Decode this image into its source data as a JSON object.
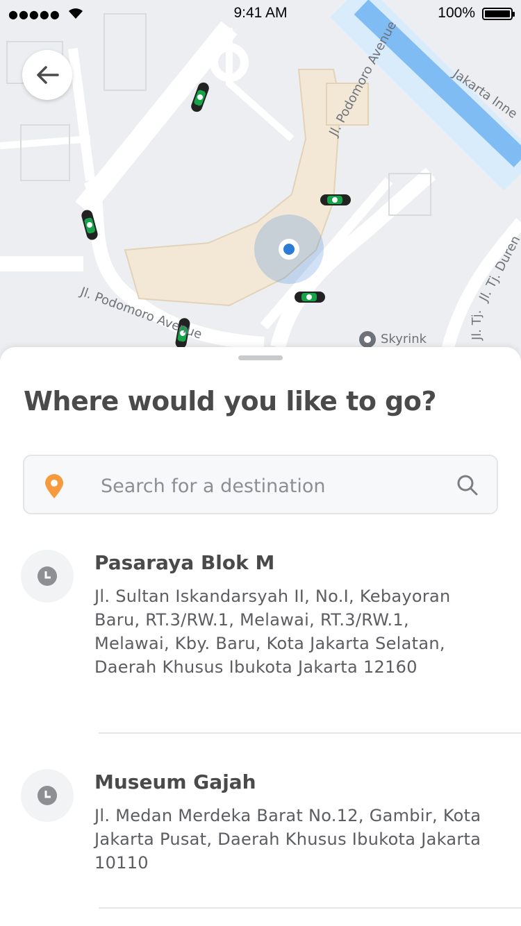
{
  "status_bar": {
    "signal": "●●●●●",
    "time": "9:41 AM",
    "battery": "100%"
  },
  "map": {
    "labels": {
      "podomoro_avenue_1": "Jl. Podomoro Avenue",
      "podomoro_avenue_2": "Jl. Podomoro Avenue",
      "jakarta_inner": "Jakarta Inne",
      "tj_duren": "Jl. Tj. Duren",
      "tj": "Jl. Tj.",
      "skyrink": "Skyrink"
    },
    "colors": {
      "background": "#eceef1",
      "road": "#ffffff",
      "building": "#f3e8d6",
      "toll": "#7fbcf3",
      "location": "#2c7bd6",
      "driver": "#17a34a"
    }
  },
  "sheet": {
    "title": "Where would you like to go?",
    "search": {
      "placeholder": "Search for a destination",
      "value": ""
    },
    "recent": [
      {
        "name": "Pasaraya Blok M",
        "address": "Jl. Sultan Iskandarsyah II, No.I, Kebayoran Baru, RT.3/RW.1, Melawai, RT.3/RW.1, Melawai, Kby. Baru, Kota Jakarta Selatan, Daerah Khusus Ibukota Jakarta 12160"
      },
      {
        "name": "Museum Gajah",
        "address": "Jl. Medan Merdeka Barat No.12, Gambir, Kota Jakarta Pusat, Daerah Khusus Ibukota Jakarta 10110"
      }
    ],
    "accent_color": "#f79a3e"
  }
}
